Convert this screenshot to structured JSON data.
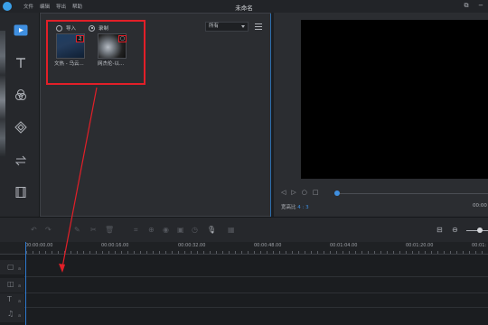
{
  "titlebar": {
    "title": "未命名",
    "menu": [
      "文件",
      "编辑",
      "导出",
      "帮助"
    ]
  },
  "sidebar": {
    "items": [
      {
        "name": "media-icon",
        "active": true
      },
      {
        "name": "text-icon"
      },
      {
        "name": "filter-icon"
      },
      {
        "name": "overlay-icon"
      },
      {
        "name": "transition-icon"
      },
      {
        "name": "film-icon"
      }
    ]
  },
  "media": {
    "source_import": "导入",
    "source_record": "录制",
    "filter_value": "所有",
    "thumb1_label": "文热 - 乌云...",
    "thumb2_label": "网杰伦-以..."
  },
  "preview": {
    "ratio_label": "宽高比",
    "ratio_value": "4 : 3",
    "timecode": "00:00"
  },
  "timeline": {
    "ruler": [
      "00:00:00.00",
      "00:00:16.00",
      "00:00:32.00",
      "00:00:48.00",
      "00:01:04.00",
      "00:01:20.00",
      "00:01:"
    ]
  },
  "colors": {
    "accent": "#3f8fe0",
    "annotation": "#e21f28"
  }
}
